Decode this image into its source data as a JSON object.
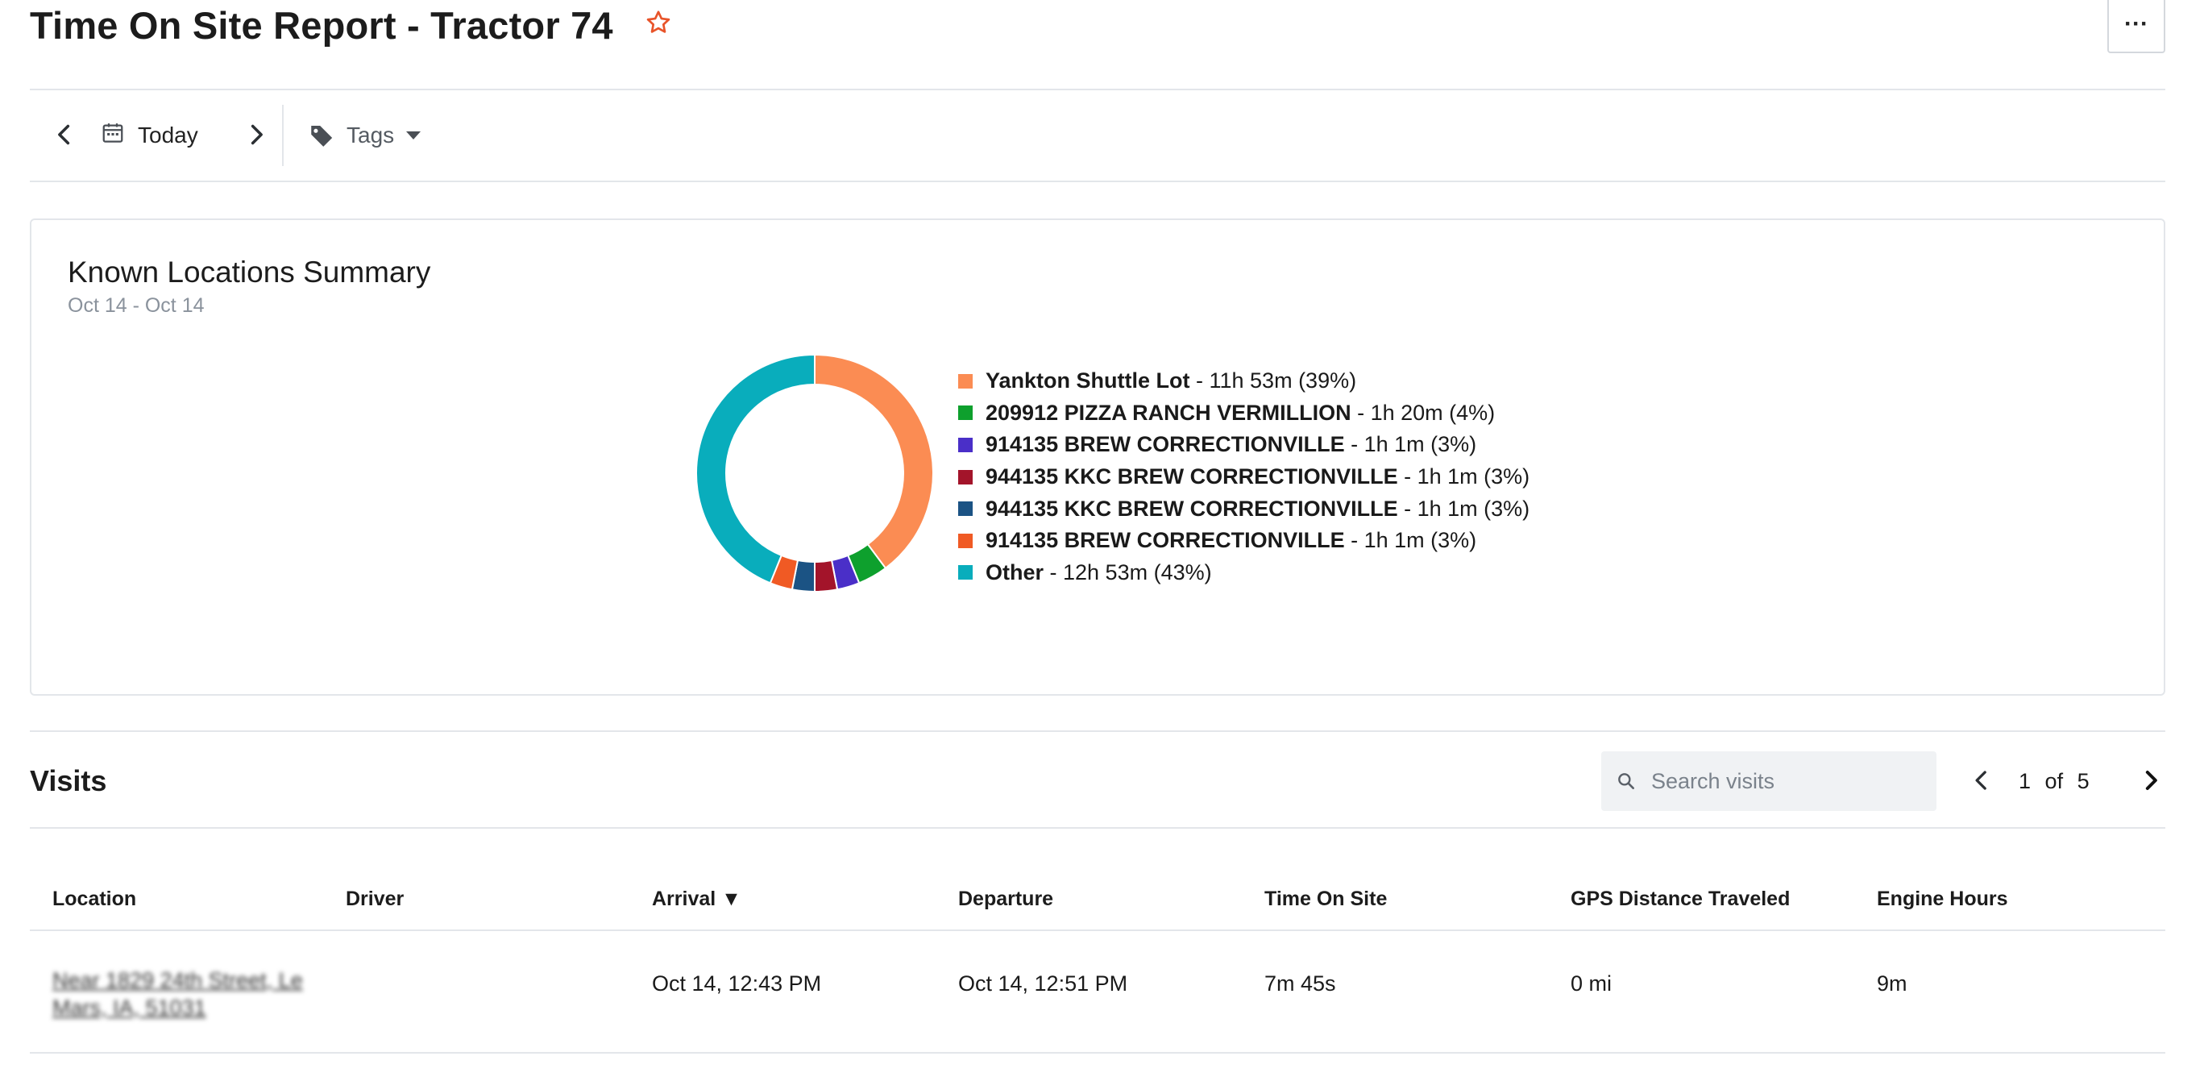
{
  "header": {
    "title": "Time On Site Report - Tractor 74",
    "more_label": "···"
  },
  "toolbar": {
    "date_label": "Today",
    "tags_label": "Tags"
  },
  "summary": {
    "title": "Known Locations Summary",
    "date_range": "Oct 14 - Oct 14",
    "legend": [
      {
        "name": "Yankton Shuttle Lot",
        "detail": " - 11h 53m (39%)",
        "color": "#fb8c53"
      },
      {
        "name": "209912 PIZZA RANCH VERMILLION",
        "detail": " - 1h 20m (4%)",
        "color": "#0ea02d"
      },
      {
        "name": "914135 BREW CORRECTIONVILLE",
        "detail": " - 1h 1m (3%)",
        "color": "#4a2fc8"
      },
      {
        "name": "944135 KKC BREW CORRECTIONVILLE",
        "detail": " - 1h 1m (3%)",
        "color": "#a3142a"
      },
      {
        "name": "944135 KKC BREW CORRECTIONVILLE",
        "detail": " - 1h 1m (3%)",
        "color": "#1b5384"
      },
      {
        "name": "914135 BREW CORRECTIONVILLE",
        "detail": " - 1h 1m (3%)",
        "color": "#f05a24"
      },
      {
        "name": "Other",
        "detail": " - 12h 53m (43%)",
        "color": "#09adbc"
      }
    ]
  },
  "chart_data": {
    "type": "pie",
    "variant": "donut",
    "categories": [
      "Yankton Shuttle Lot",
      "209912 PIZZA RANCH VERMILLION",
      "914135 BREW CORRECTIONVILLE",
      "944135 KKC BREW CORRECTIONVILLE",
      "944135 KKC BREW CORRECTIONVILLE",
      "914135 BREW CORRECTIONVILLE",
      "Other"
    ],
    "values": [
      39,
      4,
      3,
      3,
      3,
      3,
      43
    ],
    "colors": [
      "#fb8c53",
      "#0ea02d",
      "#4a2fc8",
      "#a3142a",
      "#1b5384",
      "#f05a24",
      "#09adbc"
    ],
    "legend_position": "right"
  },
  "visits": {
    "title": "Visits",
    "search_placeholder": "Search visits",
    "page_current": "1",
    "page_of": "of",
    "page_total": "5",
    "columns": [
      "Location",
      "Driver",
      "Arrival ▼",
      "Departure",
      "Time On Site",
      "GPS Distance Traveled",
      "Engine Hours"
    ],
    "rows": [
      {
        "location": "Near 1829 24th Street, Le Mars, IA, 51031",
        "driver": "",
        "arrival": "Oct 14, 12:43 PM",
        "departure": "Oct 14, 12:51 PM",
        "time_on_site": "7m 45s",
        "gps_distance": "0 mi",
        "engine_hours": "9m"
      }
    ]
  },
  "icons": {
    "star": "star-outline-icon",
    "calendar": "calendar-icon",
    "tag": "tag-icon",
    "search": "search-icon"
  },
  "colors": {
    "accent": "#e8542a",
    "border": "#e3e6ea"
  }
}
